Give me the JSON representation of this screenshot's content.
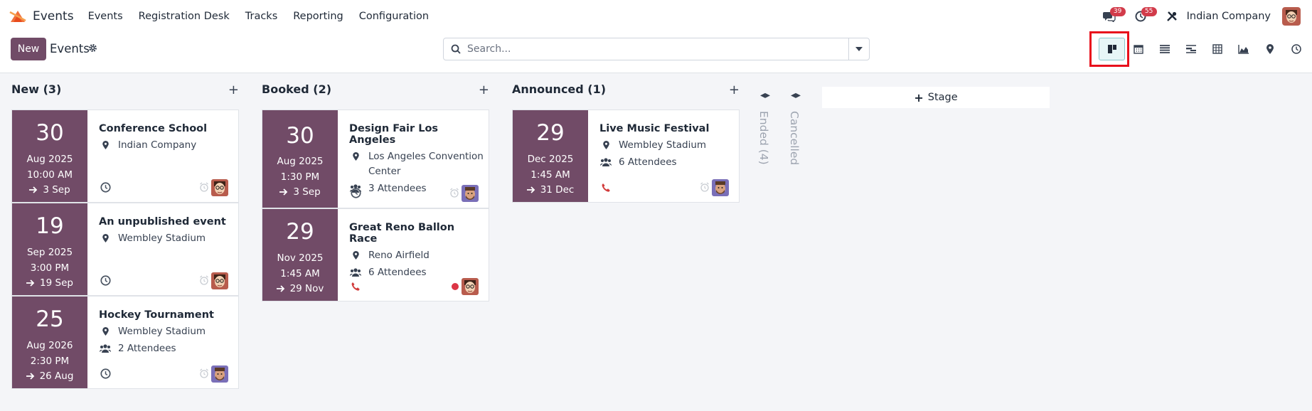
{
  "app": {
    "name": "Events"
  },
  "menu": [
    "Events",
    "Registration Desk",
    "Tracks",
    "Reporting",
    "Configuration"
  ],
  "systray": {
    "messages_count": "39",
    "activities_count": "55",
    "company": "Indian Company"
  },
  "control": {
    "new_label": "New",
    "title": "Events",
    "search_placeholder": "Search...",
    "views": [
      "kanban",
      "calendar",
      "list",
      "gantt",
      "pivot",
      "graph",
      "map",
      "activity"
    ],
    "active_view": "kanban"
  },
  "columns": [
    {
      "title": "New (3)",
      "cards": [
        {
          "day": "30",
          "monthyear": "Aug 2025",
          "time": "10:00 AM",
          "end": "3 Sep",
          "name": "Conference School",
          "location": "Indian Company",
          "attendees": "",
          "bottom_icon": "clock-icon",
          "status": "clock-grey",
          "avatar": "man-glasses"
        },
        {
          "day": "19",
          "monthyear": "Sep 2025",
          "time": "3:00 PM",
          "end": "19 Sep",
          "name": "An unpublished event",
          "location": "Wembley Stadium",
          "attendees": "",
          "bottom_icon": "clock-icon",
          "status": "clock-grey",
          "avatar": "man-glasses"
        },
        {
          "day": "25",
          "monthyear": "Aug 2026",
          "time": "2:30 PM",
          "end": "26 Aug",
          "name": "Hockey Tournament",
          "location": "Wembley Stadium",
          "attendees": "2 Attendees",
          "bottom_icon": "clock-icon",
          "status": "clock-grey",
          "avatar": "man-beard"
        }
      ]
    },
    {
      "title": "Booked (2)",
      "cards": [
        {
          "day": "30",
          "monthyear": "Aug 2025",
          "time": "1:30 PM",
          "end": "3 Sep",
          "name": "Design Fair Los Angeles",
          "location": "Los Angeles Convention Center",
          "attendees": "3 Attendees",
          "bottom_icon": "clock-icon",
          "status": "clock-grey",
          "avatar": "man-beard"
        },
        {
          "day": "29",
          "monthyear": "Nov 2025",
          "time": "1:45 AM",
          "end": "29 Nov",
          "name": "Great Reno Ballon Race",
          "location": "Reno Airfield",
          "attendees": "6 Attendees",
          "bottom_icon": "phone-icon",
          "status": "red-dot",
          "avatar": "man-glasses"
        }
      ]
    },
    {
      "title": "Announced (1)",
      "cards": [
        {
          "day": "29",
          "monthyear": "Dec 2025",
          "time": "1:45 AM",
          "end": "31 Dec",
          "name": "Live Music Festival",
          "location": "Wembley Stadium",
          "attendees": "6 Attendees",
          "bottom_icon": "phone-icon",
          "status": "clock-grey",
          "avatar": "man-beard"
        }
      ]
    }
  ],
  "folded_columns": [
    {
      "title": "Ended (4)"
    },
    {
      "title": "Cancelled"
    }
  ],
  "add_stage_label": "Stage",
  "colors": {
    "brand": "#714b67",
    "accent": "#017e84",
    "badge": "#d23b4a",
    "highlight": "#e8101c"
  }
}
